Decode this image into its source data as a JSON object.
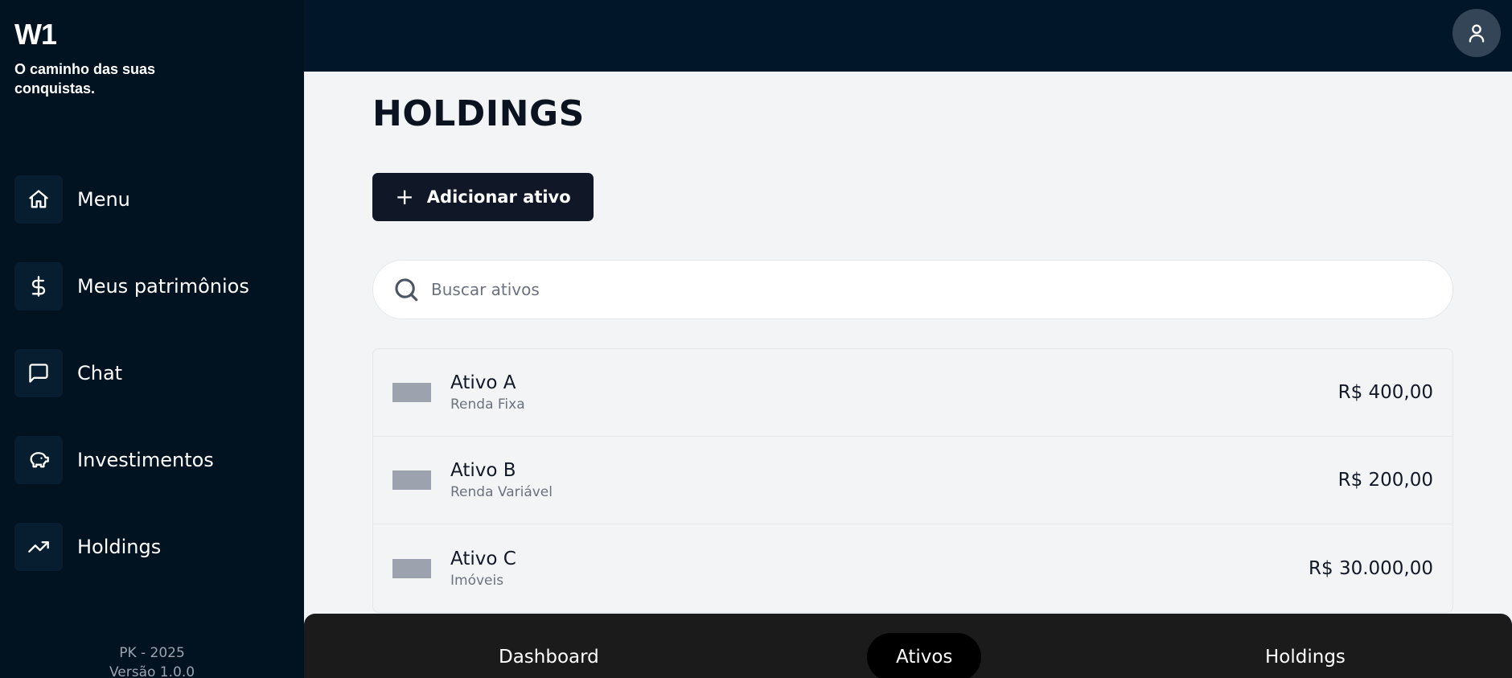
{
  "brand": {
    "logo": "W1",
    "tagline": "O caminho das suas conquistas."
  },
  "sidebar": {
    "items": [
      {
        "label": "Menu",
        "icon": "home-icon"
      },
      {
        "label": "Meus patrimônios",
        "icon": "dollar-icon"
      },
      {
        "label": "Chat",
        "icon": "chat-icon"
      },
      {
        "label": "Investimentos",
        "icon": "piggy-bank-icon"
      },
      {
        "label": "Holdings",
        "icon": "trending-up-icon"
      }
    ],
    "footer": {
      "line1": "PK - 2025",
      "line2": "Versão 1.0.0"
    }
  },
  "header": {
    "avatar_icon": "user-icon"
  },
  "main": {
    "title": "HOLDINGS",
    "add_button": {
      "label": "Adicionar ativo",
      "icon": "plus-icon"
    },
    "search": {
      "placeholder": "Buscar ativos",
      "value": ""
    },
    "assets": [
      {
        "name": "Ativo A",
        "type": "Renda Fixa",
        "value": "R$ 400,00"
      },
      {
        "name": "Ativo B",
        "type": "Renda Variável",
        "value": "R$ 200,00"
      },
      {
        "name": "Ativo C",
        "type": "Imóveis",
        "value": "R$ 30.000,00"
      }
    ]
  },
  "bottom_nav": {
    "tabs": [
      {
        "label": "Dashboard",
        "active": false
      },
      {
        "label": "Ativos",
        "active": true
      },
      {
        "label": "Holdings",
        "active": false
      }
    ]
  },
  "colors": {
    "sidebar_bg": "#011221",
    "topbar_bg": "#011629",
    "main_bg": "#f3f4f6",
    "primary_button": "#101828",
    "bottom_bar": "#1b1b1b"
  }
}
